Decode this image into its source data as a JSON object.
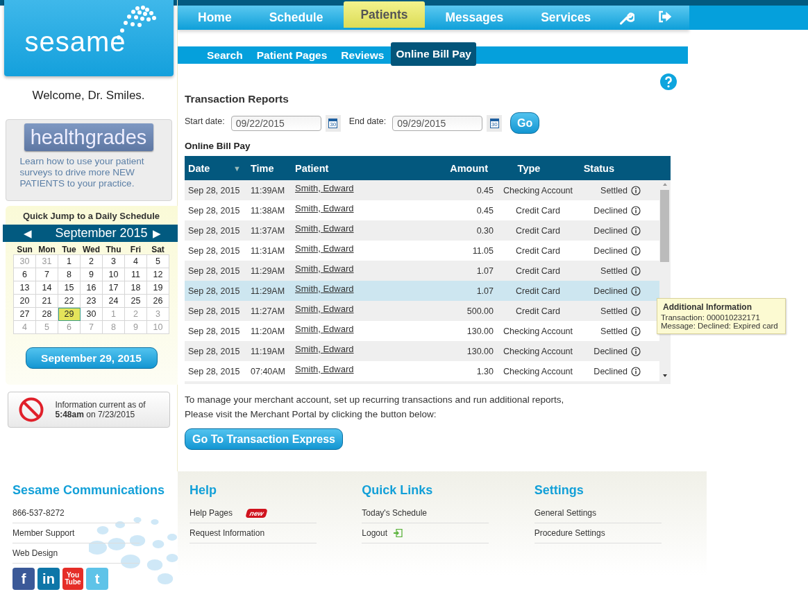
{
  "logo": {
    "text": "sesame"
  },
  "nav": [
    {
      "label": "Home",
      "selected": false
    },
    {
      "label": "Schedule",
      "selected": false
    },
    {
      "label": "Patients",
      "selected": true
    },
    {
      "label": "Messages",
      "selected": false
    },
    {
      "label": "Services",
      "selected": false
    }
  ],
  "nav_icons": [
    {
      "kind": "wrench"
    },
    {
      "kind": "logout"
    }
  ],
  "subnav": [
    {
      "label": "Search",
      "selected": false
    },
    {
      "label": "Patient Pages",
      "selected": false
    },
    {
      "label": "Reviews",
      "selected": false
    },
    {
      "label": "Online Bill Pay",
      "selected": true
    }
  ],
  "welcome": "Welcome, Dr. Smiles.",
  "promo": {
    "logo": "healthgrades",
    "text": "Learn how to use your patient surveys to drive more NEW PATIENTS to your practice."
  },
  "quick_jump": {
    "title": "Quick Jump to a Daily Schedule",
    "prev": "◀",
    "next": "▶",
    "month": "September 2015",
    "weekdays": [
      "Sun",
      "Mon",
      "Tue",
      "Wed",
      "Thu",
      "Fri",
      "Sat"
    ],
    "days": [
      {
        "label": "30",
        "muted": true,
        "selected": false
      },
      {
        "label": "31",
        "muted": true,
        "selected": false
      },
      {
        "label": "1",
        "muted": false,
        "selected": false
      },
      {
        "label": "2",
        "muted": false,
        "selected": false
      },
      {
        "label": "3",
        "muted": false,
        "selected": false
      },
      {
        "label": "4",
        "muted": false,
        "selected": false
      },
      {
        "label": "5",
        "muted": false,
        "selected": false
      },
      {
        "label": "6",
        "muted": false,
        "selected": false
      },
      {
        "label": "7",
        "muted": false,
        "selected": false
      },
      {
        "label": "8",
        "muted": false,
        "selected": false
      },
      {
        "label": "9",
        "muted": false,
        "selected": false
      },
      {
        "label": "10",
        "muted": false,
        "selected": false
      },
      {
        "label": "11",
        "muted": false,
        "selected": false
      },
      {
        "label": "12",
        "muted": false,
        "selected": false
      },
      {
        "label": "13",
        "muted": false,
        "selected": false
      },
      {
        "label": "14",
        "muted": false,
        "selected": false
      },
      {
        "label": "15",
        "muted": false,
        "selected": false
      },
      {
        "label": "16",
        "muted": false,
        "selected": false
      },
      {
        "label": "17",
        "muted": false,
        "selected": false
      },
      {
        "label": "18",
        "muted": false,
        "selected": false
      },
      {
        "label": "19",
        "muted": false,
        "selected": false
      },
      {
        "label": "20",
        "muted": false,
        "selected": false
      },
      {
        "label": "21",
        "muted": false,
        "selected": false
      },
      {
        "label": "22",
        "muted": false,
        "selected": false
      },
      {
        "label": "23",
        "muted": false,
        "selected": false
      },
      {
        "label": "24",
        "muted": false,
        "selected": false
      },
      {
        "label": "25",
        "muted": false,
        "selected": false
      },
      {
        "label": "26",
        "muted": false,
        "selected": false
      },
      {
        "label": "27",
        "muted": false,
        "selected": false
      },
      {
        "label": "28",
        "muted": false,
        "selected": false
      },
      {
        "label": "29",
        "muted": false,
        "selected": true
      },
      {
        "label": "30",
        "muted": false,
        "selected": false
      },
      {
        "label": "1",
        "muted": true,
        "selected": false
      },
      {
        "label": "2",
        "muted": true,
        "selected": false
      },
      {
        "label": "3",
        "muted": true,
        "selected": false
      },
      {
        "label": "4",
        "muted": true,
        "selected": false
      },
      {
        "label": "5",
        "muted": true,
        "selected": false
      },
      {
        "label": "6",
        "muted": true,
        "selected": false
      },
      {
        "label": "7",
        "muted": true,
        "selected": false
      },
      {
        "label": "8",
        "muted": true,
        "selected": false
      },
      {
        "label": "9",
        "muted": true,
        "selected": false
      },
      {
        "label": "10",
        "muted": true,
        "selected": false
      }
    ],
    "date_button": "September 29, 2015"
  },
  "info_notice": "Information current as of **5:48am** on 7/23/2015",
  "page_title": "Transaction Reports",
  "filters": {
    "start_label": "Start date:",
    "start_value": "09/22/2015",
    "end_label": "End date:",
    "end_value": "09/29/2015",
    "start_calendar_icon": "30",
    "end_calendar_icon": "30",
    "go": "Go"
  },
  "section_title": "Online Bill Pay",
  "table": {
    "columns": [
      "Date",
      "Time",
      "Patient",
      "Amount",
      "Type",
      "Status"
    ],
    "sort_indicator": "▼",
    "rows": [
      {
        "date": "Sep 28, 2015",
        "time": "11:39AM",
        "patient": "Smith, Edward",
        "amount": "0.45",
        "type": "Checking Account",
        "status": "Settled",
        "selected": false
      },
      {
        "date": "Sep 28, 2015",
        "time": "11:38AM",
        "patient": "Smith, Edward",
        "amount": "0.45",
        "type": "Credit Card",
        "status": "Declined",
        "selected": false
      },
      {
        "date": "Sep 28, 2015",
        "time": "11:37AM",
        "patient": "Smith, Edward",
        "amount": "0.30",
        "type": "Credit Card",
        "status": "Declined",
        "selected": false
      },
      {
        "date": "Sep 28, 2015",
        "time": "11:31AM",
        "patient": "Smith, Edward",
        "amount": "11.05",
        "type": "Credit Card",
        "status": "Declined",
        "selected": false
      },
      {
        "date": "Sep 28, 2015",
        "time": "11:29AM",
        "patient": "Smith, Edward",
        "amount": "1.07",
        "type": "Credit Card",
        "status": "Settled",
        "selected": false
      },
      {
        "date": "Sep 28, 2015",
        "time": "11:29AM",
        "patient": "Smith, Edward",
        "amount": "1.07",
        "type": "Credit Card",
        "status": "Declined",
        "selected": true
      },
      {
        "date": "Sep 28, 2015",
        "time": "11:27AM",
        "patient": "Smith, Edward",
        "amount": "500.00",
        "type": "Credit Card",
        "status": "Settled",
        "selected": false
      },
      {
        "date": "Sep 28, 2015",
        "time": "11:20AM",
        "patient": "Smith, Edward",
        "amount": "130.00",
        "type": "Checking Account",
        "status": "Settled",
        "selected": false
      },
      {
        "date": "Sep 28, 2015",
        "time": "11:19AM",
        "patient": "Smith, Edward",
        "amount": "130.00",
        "type": "Checking Account",
        "status": "Declined",
        "selected": false
      },
      {
        "date": "Sep 28, 2015",
        "time": "07:40AM",
        "patient": "Smith, Edward",
        "amount": "1.30",
        "type": "Checking Account",
        "status": "Declined",
        "selected": false
      }
    ]
  },
  "tooltip": {
    "title": "Additional Information",
    "lines": [
      "Transaction: 000010232171",
      "Message: Declined: Expired card"
    ]
  },
  "merchant_text": [
    "To manage your merchant account, set up recurring transactions and run additional reports,",
    "Please visit the Merchant Portal by clicking the button below:"
  ],
  "merchant_button": "Go To Transaction Express",
  "footer": {
    "company": {
      "title": "Sesame Communications",
      "items": [
        "866-537-8272",
        "Member Support",
        "Web Design"
      ]
    },
    "social": [
      {
        "kind": "facebook",
        "label": "f"
      },
      {
        "kind": "linkedin",
        "label": "in"
      },
      {
        "kind": "youtube",
        "label": "You Tube"
      },
      {
        "kind": "twitter",
        "label": "t"
      }
    ],
    "columns": [
      {
        "title": "Help",
        "items": [
          {
            "label": "Help Pages",
            "badge": "new",
            "icon": false
          },
          {
            "label": "Request Information",
            "icon": false
          }
        ]
      },
      {
        "title": "Quick Links",
        "items": [
          {
            "label": "Today's Schedule",
            "icon": false
          },
          {
            "label": "Logout",
            "icon": true
          }
        ]
      },
      {
        "title": "Settings",
        "items": [
          {
            "label": "General Settings",
            "icon": false
          },
          {
            "label": "Procedure Settings",
            "icon": false
          }
        ]
      }
    ]
  }
}
